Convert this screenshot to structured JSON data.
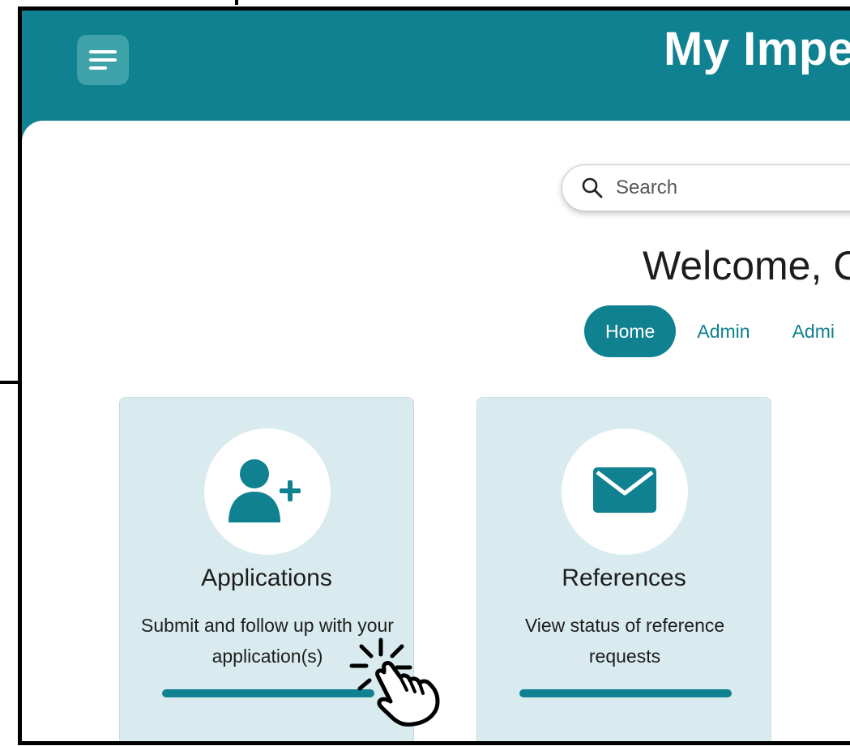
{
  "header": {
    "title": "My Impe",
    "menu_icon": "hamburger-menu-icon",
    "background_color": "#108190"
  },
  "search": {
    "placeholder": "Search",
    "icon": "search-icon"
  },
  "welcome": {
    "text": "Welcome, C"
  },
  "tabs": [
    {
      "label": "Home",
      "active": true
    },
    {
      "label": "Admin",
      "active": false
    },
    {
      "label": "Admi",
      "active": false
    }
  ],
  "cards": [
    {
      "title": "Applications",
      "description": "Submit and follow up with your application(s)",
      "icon": "add-user-icon"
    },
    {
      "title": "References",
      "description": "View status of reference requests",
      "icon": "envelope-icon"
    }
  ],
  "overlay": {
    "icon": "pointing-hand-click-icon"
  },
  "colors": {
    "accent": "#108190",
    "card_background": "#d9ebee",
    "menu_button": "#3fa2a9"
  }
}
